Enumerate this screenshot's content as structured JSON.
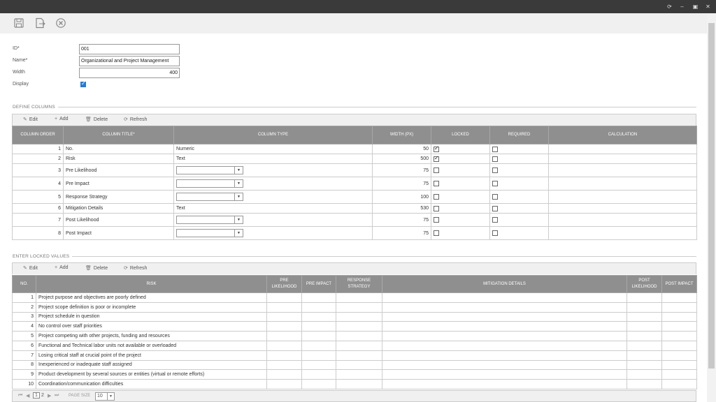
{
  "window": {
    "restore_icon": "restore-icon",
    "min_label": "–",
    "max_label": "▣",
    "close_label": "✕"
  },
  "form": {
    "id_label": "ID*",
    "id_value": "001",
    "name_label": "Name*",
    "name_value": "Organizational and Project Management",
    "width_label": "Width",
    "width_value": "400",
    "display_label": "Display"
  },
  "define_columns": {
    "section_title": "DEFINE COLUMNS",
    "toolbar": {
      "edit": "Edit",
      "add": "Add",
      "delete": "Delete",
      "refresh": "Refresh"
    },
    "headers": [
      "COLUMN ORDER",
      "COLUMN TITLE*",
      "COLUMN TYPE",
      "WIDTH (PX)",
      "LOCKED",
      "REQUIRED",
      "CALCULATION"
    ],
    "rows": [
      {
        "order": "1",
        "title": "No.",
        "type": "Numeric",
        "width": "50",
        "locked": true,
        "required": false
      },
      {
        "order": "2",
        "title": "Risk",
        "type": "Text",
        "width": "500",
        "locked": true,
        "required": false
      },
      {
        "order": "3",
        "title": "Pre Likelihood",
        "type": "",
        "width": "75",
        "locked": false,
        "required": false
      },
      {
        "order": "4",
        "title": "Pre Impact",
        "type": "",
        "width": "75",
        "locked": false,
        "required": false
      },
      {
        "order": "5",
        "title": "Response Strategy",
        "type": "",
        "width": "100",
        "locked": false,
        "required": false
      },
      {
        "order": "6",
        "title": "Mitigation Details",
        "type": "Text",
        "width": "530",
        "locked": false,
        "required": false
      },
      {
        "order": "7",
        "title": "Post Likelihood",
        "type": "",
        "width": "75",
        "locked": false,
        "required": false
      },
      {
        "order": "8",
        "title": "Post Impact",
        "type": "",
        "width": "75",
        "locked": false,
        "required": false
      }
    ]
  },
  "locked_values": {
    "section_title": "ENTER LOCKED VALUES",
    "toolbar": {
      "edit": "Edit",
      "add": "Add",
      "delete": "Delete",
      "refresh": "Refresh"
    },
    "headers": [
      "NO.",
      "RISK",
      "PRE LIKELIHOOD",
      "PRE IMPACT",
      "RESPONSE STRATEGY",
      "MITIGATION DETAILS",
      "POST LIKELIHOOD",
      "POST IMPACT"
    ],
    "rows": [
      {
        "no": "1",
        "risk": "Project purpose and objectives are poorly defined"
      },
      {
        "no": "2",
        "risk": "Project scope definition is poor or incomplete"
      },
      {
        "no": "3",
        "risk": "Project schedule in question"
      },
      {
        "no": "4",
        "risk": "No control over staff priorities"
      },
      {
        "no": "5",
        "risk": "Project competing with other projects, funding and resources"
      },
      {
        "no": "6",
        "risk": "Functional and Technical labor units not available or overloaded"
      },
      {
        "no": "7",
        "risk": "Losing critical staff at crucial point of the project"
      },
      {
        "no": "8",
        "risk": "Inexperienced or inadequate staff assigned"
      },
      {
        "no": "9",
        "risk": "Product development by several sources or entities (virtual or remote efforts)"
      },
      {
        "no": "10",
        "risk": "Coordination/communication difficulties"
      }
    ]
  },
  "pager": {
    "page1": "1",
    "page2": "2",
    "page_size_label": "PAGE SIZE",
    "page_size_value": "10"
  }
}
